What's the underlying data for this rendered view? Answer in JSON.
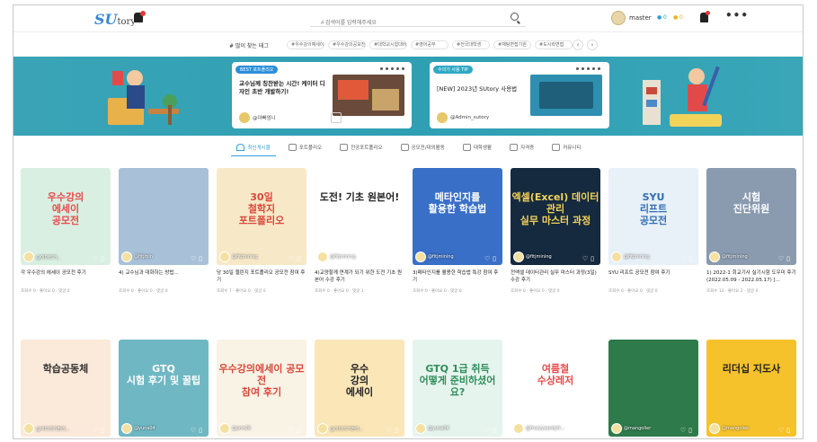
{
  "header": {
    "logo_text": "SU",
    "logo_sub": "tory",
    "search_placeholder": "# 검색어를 입력해주세요",
    "username": "master",
    "stat1": "0",
    "stat2": "0",
    "more_label": "•••"
  },
  "tags": {
    "label": "# 많이 찾는 태그",
    "items": [
      "#우수강의예세이",
      "#우수강의공모전",
      "#대학교시험대비",
      "#영어공부",
      "#전국대학생",
      "#채팅면접기원",
      "#도시락면접"
    ]
  },
  "banner": {
    "left": {
      "badge": "BEST 포트폴리오",
      "title": "교수님께 칭찬받는 시간! 케이터 디자인 초반 개발하기!",
      "author": "@아빠엄니"
    },
    "right": {
      "badge": "수의기 사용 TIP",
      "title": "[NEW] 2023년 SUtory 사용법",
      "author": "@Admin_sutory"
    }
  },
  "categories": [
    {
      "label": "최신게시물",
      "active": true
    },
    {
      "label": "포트폴리오",
      "active": false
    },
    {
      "label": "전공포트폴리오",
      "active": false
    },
    {
      "label": "공모전/대외활동",
      "active": false
    },
    {
      "label": "대학생활",
      "active": false
    },
    {
      "label": "자격증",
      "active": false
    },
    {
      "label": "커뮤니티",
      "active": false
    }
  ],
  "posts_row1": [
    {
      "thumb_text": "우수강의\n에세이\n공모전",
      "bg": "#d9efe2",
      "fg": "#e84a4a",
      "user": "",
      "title": "각 우수강의 에세이 공모전 후기",
      "meta": "조회수 0 · 좋아요 0 · 댓글 0"
    },
    {
      "thumb_text": "",
      "bg": "#a9c1d8",
      "fg": "#333",
      "user": "",
      "title": "4) 교수님과 대화하는 방법...",
      "meta": "조회수 0 · 좋아요 0 · 댓글 0"
    },
    {
      "thumb_text": "30일\n철학지\n포트폴리오",
      "bg": "#f7e9c8",
      "fg": "#d9473a",
      "user": "",
      "title": "당 30일 챌린지 포트폴리오 공모전 참여 후기",
      "meta": "조회수 7 · 좋아요 0 · 댓글 0"
    },
    {
      "thumb_text": "도전! 기초 원본어!",
      "bg": "#ffffff",
      "fg": "#222",
      "user": "",
      "title": "4)교양할께 연계가 되기 위한 도전 기초 원본어 수강 후기",
      "meta": "조회수 0 · 좋아요 0 · 댓글 1"
    },
    {
      "thumb_text": "메타인지를\n활용한 학습법",
      "bg": "#3a6fc7",
      "fg": "#fff",
      "user": "",
      "title": "3)메타인지를 활용한 학습법 특강 참여 후기",
      "meta": "조회수 0 · 좋아요 0 · 댓글 0"
    },
    {
      "thumb_text": "엑셀(Excel) 데이터관리\n실무 마스터 과정",
      "bg": "#152a3e",
      "fg": "#f5d35a",
      "user": "",
      "title": "전액셀 데이터관리 실무 마스터 과정(3일) 수강 후기",
      "meta": "조회수 0 · 좋아요 0 · 댓글 0"
    },
    {
      "thumb_text": "SYU\n리프트\n공모전",
      "bg": "#e8f0f8",
      "fg": "#2f6fb3",
      "user": "",
      "title": "SYU 리프트 공모전 참여 후기",
      "meta": "조회수 0 · 좋아요 0 · 댓글 0"
    },
    {
      "thumb_text": "시험\n진단위원",
      "bg": "#8a9bb0",
      "fg": "#fff",
      "user": "",
      "title": "1) 2022-1 회교기사 실기시험 도우미 후기 (2022.05.09 - 2022.05.17) [...",
      "meta": "조회수 12 · 좋아요 2 · 댓글 0"
    }
  ],
  "posts_row2": [
    {
      "thumb_text": "학습공동체",
      "bg": "#fbe9d9",
      "fg": "#333"
    },
    {
      "thumb_text": "GTQ\n시험 후기 및 꿀팁",
      "bg": "#6fb8c3",
      "fg": "#fff"
    },
    {
      "thumb_text": "우수강의에세이 공모전\n참여 후기",
      "bg": "#f9f3e6",
      "fg": "#d9473a"
    },
    {
      "thumb_text": "우수\n강의\n에세이",
      "bg": "#fbe6b8",
      "fg": "#222"
    },
    {
      "thumb_text": "GTQ 1급 취득\n어떻게 준비하셨어요?",
      "bg": "#e6f4ee",
      "fg": "#2f8f5a"
    },
    {
      "thumb_text": "여름철\n수상레저",
      "bg": "#ffffff",
      "fg": "#e84a4a"
    },
    {
      "thumb_text": "",
      "bg": "#2f7a4a",
      "fg": "#fff"
    },
    {
      "thumb_text": "리더십 지도사",
      "bg": "#f6c22b",
      "fg": "#222"
    }
  ],
  "row2_users": [
    "@이다리거편리...",
    "@yuna04",
    "@prin26",
    "@이다리거편리...",
    "@yuna04",
    "@frozzysandyfr...",
    "@mangolier",
    "@mangolier"
  ],
  "row1_users": [
    "@이다리거..",
    "@fitjmin",
    "@fitjmining",
    "@fitjmining",
    "@fitjmining",
    "@fitjmining",
    "@fitjmining",
    "@fitjmining"
  ],
  "colors": {
    "accent": "#2f9fd8",
    "banner": "#3aa4b6"
  }
}
